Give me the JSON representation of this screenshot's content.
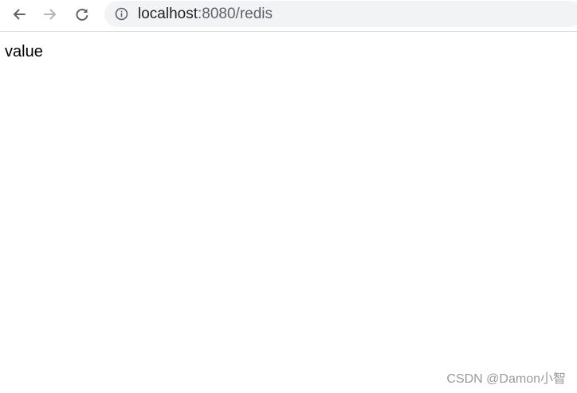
{
  "browser": {
    "url_host": "localhost",
    "url_rest": ":8080/redis",
    "icons": {
      "back": "arrow-left-icon",
      "forward": "arrow-right-icon",
      "reload": "reload-icon",
      "site_info": "info-icon"
    },
    "forward_enabled": false
  },
  "page": {
    "body_text": "value"
  },
  "watermark": {
    "text": "CSDN @Damon小智"
  }
}
